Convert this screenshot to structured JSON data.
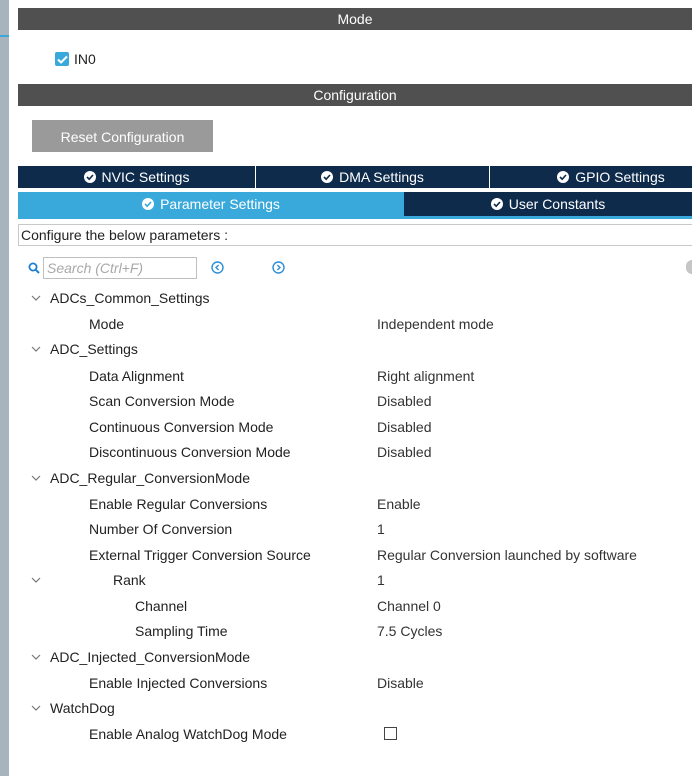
{
  "mode": {
    "title": "Mode",
    "checkbox": {
      "label": "IN0",
      "checked": true
    }
  },
  "configuration": {
    "title": "Configuration",
    "reset_label": "Reset Configuration",
    "tabs_row1": [
      "NVIC Settings",
      "DMA Settings",
      "GPIO Settings"
    ],
    "tabs_row2": [
      "Parameter Settings",
      "User Constants"
    ],
    "active_tab": "Parameter Settings",
    "info": "Configure the below parameters :",
    "search_placeholder": "Search (Ctrl+F)"
  },
  "tree": {
    "g1": {
      "name": "ADCs_Common_Settings",
      "p1": {
        "label": "Mode",
        "value": "Independent mode"
      }
    },
    "g2": {
      "name": "ADC_Settings",
      "p1": {
        "label": "Data Alignment",
        "value": "Right alignment"
      },
      "p2": {
        "label": "Scan Conversion Mode",
        "value": "Disabled"
      },
      "p3": {
        "label": "Continuous Conversion Mode",
        "value": "Disabled"
      },
      "p4": {
        "label": "Discontinuous Conversion Mode",
        "value": "Disabled"
      }
    },
    "g3": {
      "name": "ADC_Regular_ConversionMode",
      "p1": {
        "label": "Enable Regular Conversions",
        "value": "Enable"
      },
      "p2": {
        "label": "Number Of Conversion",
        "value": "1"
      },
      "p3": {
        "label": "External Trigger Conversion Source",
        "value": "Regular Conversion launched by software"
      },
      "rank": {
        "label": "Rank",
        "value": "1"
      },
      "r1": {
        "label": "Channel",
        "value": "Channel 0"
      },
      "r2": {
        "label": "Sampling Time",
        "value": "7.5 Cycles"
      }
    },
    "g4": {
      "name": "ADC_Injected_ConversionMode",
      "p1": {
        "label": "Enable Injected Conversions",
        "value": "Disable"
      }
    },
    "g5": {
      "name": "WatchDog",
      "p1": {
        "label": "Enable Analog WatchDog Mode",
        "checked": false
      }
    }
  },
  "colors": {
    "accent": "#39a9dc",
    "tab_dark": "#0e2b4c",
    "section_bar": "#505050",
    "button": "#9a9a9a"
  }
}
